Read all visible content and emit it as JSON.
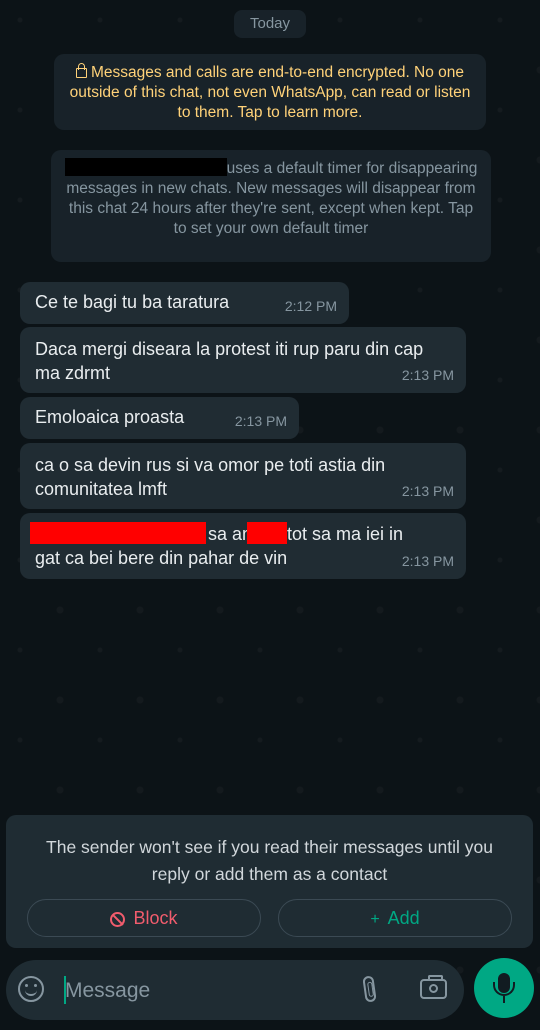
{
  "chat": {
    "date_chip": "Today",
    "encryption_notice": "Messages and calls are end-to-end encrypted. No one outside of this chat, not even WhatsApp, can read or listen to them. Tap to learn more.",
    "timer_notice_suffix": "uses a default timer for disappearing messages in new chats. New messages will disappear from this chat 24 hours after they're sent, except when kept. Tap to set your own default timer",
    "messages": [
      {
        "text": "Ce te bagi tu ba taratura",
        "time": "2:12 PM"
      },
      {
        "text": "Daca mergi diseara la protest iti rup paru din cap ma zdrmt",
        "time": "2:13 PM"
      },
      {
        "text": "Emoloaica proasta",
        "time": "2:13 PM"
      },
      {
        "text": "ca o sa devin rus si va omor pe toti astia din comunitatea lmft",
        "time": "2:13 PM"
      },
      {
        "parts": [
          "sa am",
          "tot sa ma iei in",
          "gat ca bei bere din pahar de vin"
        ],
        "time": "2:13 PM"
      }
    ]
  },
  "unknown_sender_panel": {
    "text": "The sender won't see if you read their messages until you reply or add them as a contact",
    "block_label": "Block",
    "add_label": "Add",
    "add_icon": "+"
  },
  "composer": {
    "placeholder": "Message"
  },
  "icons": {
    "lock": "lock-icon",
    "block": "block-icon",
    "add_contact": "add-contact-icon",
    "emoji": "emoji-icon",
    "attach": "attach-icon",
    "camera": "camera-icon",
    "mic": "mic-icon"
  },
  "colors": {
    "chat_background": "#0c1317",
    "bubble": "#202c33",
    "encryption_text": "#ffd279",
    "block_red": "#f15c6d",
    "accent_green": "#00a884"
  }
}
